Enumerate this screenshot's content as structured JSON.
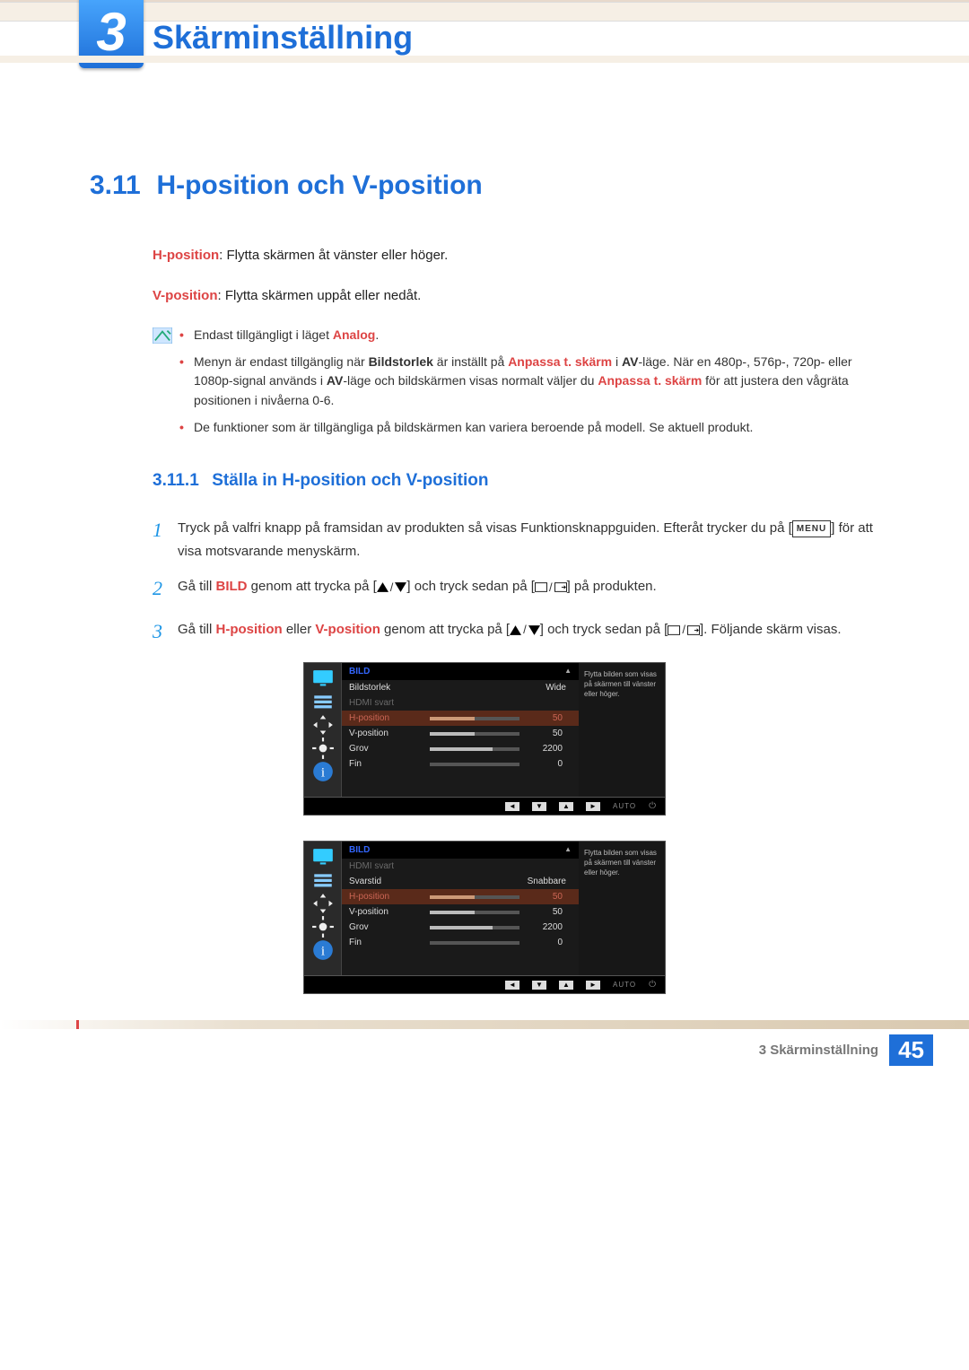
{
  "chapter": {
    "number": "3",
    "title": "Skärminställning"
  },
  "section": {
    "number": "3.11",
    "title": "H-position och V-position"
  },
  "desc_h_label": "H-position",
  "desc_h_text": ": Flytta skärmen åt vänster eller höger.",
  "desc_v_label": "V-position",
  "desc_v_text": ": Flytta skärmen uppåt eller nedåt.",
  "notes": {
    "n1_pre": "Endast tillgängligt i läget ",
    "n1_red": "Analog",
    "n1_post": ".",
    "n2_a": "Menyn är endast tillgänglig när ",
    "n2_b": "Bildstorlek",
    "n2_c": " är inställt på ",
    "n2_d": "Anpassa t. skärm",
    "n2_e": " i ",
    "n2_f": "AV",
    "n2_g": "-läge. När en 480p-, 576p-, 720p- eller 1080p-signal används i ",
    "n2_h": "AV",
    "n2_i": "-läge och bildskärmen visas normalt väljer du ",
    "n2_j": "Anpassa t. skärm",
    "n2_k": " för att justera den vågräta positionen i nivåerna 0-6.",
    "n3": "De funktioner som är tillgängliga på bildskärmen kan variera beroende på modell. Se aktuell produkt."
  },
  "subsection": {
    "number": "3.11.1",
    "title": "Ställa in H-position och V-position"
  },
  "steps": {
    "s1a": "Tryck på valfri knapp på framsidan av produkten så visas Funktionsknappguiden. Efteråt trycker du på [",
    "s1_menu": "MENU",
    "s1b": "] för att visa motsvarande menyskärm.",
    "s2a": "Gå till ",
    "s2_bild": "BILD",
    "s2b": " genom att trycka på [",
    "s2c": "] och tryck sedan på [",
    "s2d": "] på produkten.",
    "s3a": "Gå till ",
    "s3_h": "H-position",
    "s3_or": " eller ",
    "s3_v": "V-position",
    "s3b": " genom att trycka på [",
    "s3c": "] och tryck sedan på [",
    "s3d": "]. Följande skärm visas."
  },
  "osd_common": {
    "tab": "BILD",
    "help": "Flytta bilden som visas på skärmen till vänster eller höger.",
    "auto_label": "AUTO"
  },
  "osd1": {
    "rows": [
      {
        "label": "Bildstorlek",
        "value": "Wide",
        "type": "text"
      },
      {
        "label": "HDMI svart",
        "type": "dim"
      },
      {
        "label": "H-position",
        "value": "50",
        "fill": 50,
        "type": "sel"
      },
      {
        "label": "V-position",
        "value": "50",
        "fill": 50,
        "type": "bar"
      },
      {
        "label": "Grov",
        "value": "2200",
        "fill": 70,
        "type": "bar"
      },
      {
        "label": "Fin",
        "value": "0",
        "fill": 0,
        "type": "bar"
      }
    ]
  },
  "osd2": {
    "rows": [
      {
        "label": "HDMI svart",
        "type": "dim"
      },
      {
        "label": "Svarstid",
        "value": "Snabbare",
        "type": "text"
      },
      {
        "label": "H-position",
        "value": "50",
        "fill": 50,
        "type": "sel"
      },
      {
        "label": "V-position",
        "value": "50",
        "fill": 50,
        "type": "bar"
      },
      {
        "label": "Grov",
        "value": "2200",
        "fill": 70,
        "type": "bar"
      },
      {
        "label": "Fin",
        "value": "0",
        "fill": 0,
        "type": "bar"
      }
    ]
  },
  "footer": {
    "text": "3 Skärminställning",
    "page": "45"
  }
}
